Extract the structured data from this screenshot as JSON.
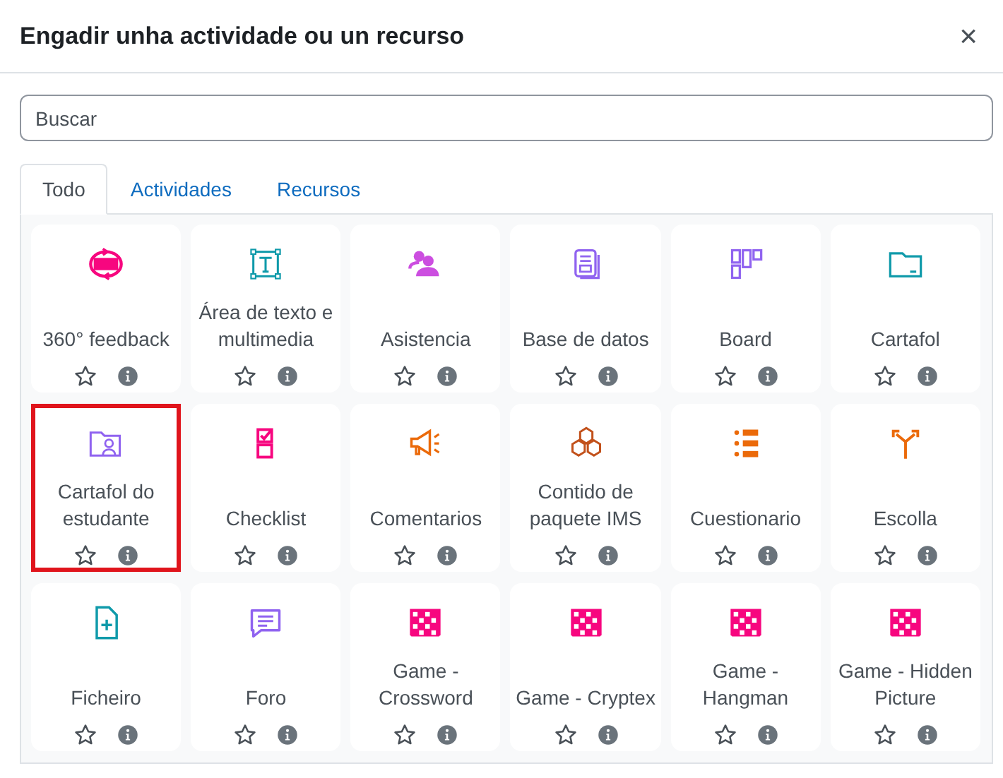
{
  "dialog": {
    "title": "Engadir unha actividade ou un recurso",
    "close": "×"
  },
  "search": {
    "placeholder": "Buscar"
  },
  "tabs": [
    {
      "label": "Todo",
      "selected": true
    },
    {
      "label": "Actividades",
      "selected": false
    },
    {
      "label": "Recursos",
      "selected": false
    }
  ],
  "items": [
    {
      "label": "360° feedback",
      "color": "#f7067f",
      "highlighted": false,
      "starred": false
    },
    {
      "label": "Área de texto e multimedia",
      "color": "#0f9aaa",
      "highlighted": false,
      "starred": false
    },
    {
      "label": "Asistencia",
      "color": "#cc4ee0",
      "highlighted": false,
      "starred": false
    },
    {
      "label": "Base de datos",
      "color": "#9063f0",
      "highlighted": false,
      "starred": false
    },
    {
      "label": "Board",
      "color": "#9063f0",
      "highlighted": false,
      "starred": false
    },
    {
      "label": "Cartafol",
      "color": "#0f9aaa",
      "highlighted": false,
      "starred": false
    },
    {
      "label": "Cartafol do estudante",
      "color": "#9063f0",
      "highlighted": true,
      "starred": false
    },
    {
      "label": "Checklist",
      "color": "#f7067f",
      "highlighted": false,
      "starred": false
    },
    {
      "label": "Comentarios",
      "color": "#eb6a0a",
      "highlighted": false,
      "starred": false
    },
    {
      "label": "Contido de paquete IMS",
      "color": "#c2511b",
      "highlighted": false,
      "starred": false
    },
    {
      "label": "Cuestionario",
      "color": "#eb6a0a",
      "highlighted": false,
      "starred": false
    },
    {
      "label": "Escolla",
      "color": "#eb6a0a",
      "highlighted": false,
      "starred": false
    },
    {
      "label": "Ficheiro",
      "color": "#0f9aaa",
      "highlighted": false,
      "starred": false
    },
    {
      "label": "Foro",
      "color": "#9063f0",
      "highlighted": false,
      "starred": false
    },
    {
      "label": "Game - Crossword",
      "color": "#f7067f",
      "highlighted": false,
      "starred": false
    },
    {
      "label": "Game - Cryptex",
      "color": "#f7067f",
      "highlighted": false,
      "starred": false
    },
    {
      "label": "Game - Hangman",
      "color": "#f7067f",
      "highlighted": false,
      "starred": false
    },
    {
      "label": "Game - Hidden Picture",
      "color": "#f7067f",
      "highlighted": false,
      "starred": false
    }
  ]
}
